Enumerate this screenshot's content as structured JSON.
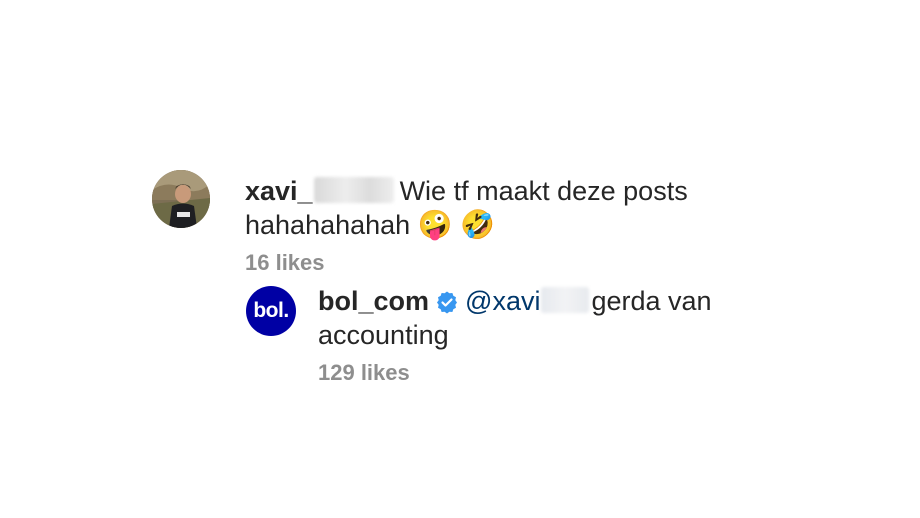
{
  "comments": [
    {
      "username": "xavi_",
      "text": "Wie tf maakt deze posts hahahahahah",
      "emojis": [
        "🤪",
        "🤣"
      ],
      "likes": "16 likes",
      "avatar_icon": "user-avatar-photo"
    }
  ],
  "reply": {
    "username": "bol_com",
    "verified_icon": "verified-badge-icon",
    "mention": "@xavi",
    "text": "gerda van accounting",
    "likes": "129 likes",
    "avatar_logo": "bol.",
    "brand_color": "#0000a4"
  },
  "colors": {
    "mention": "#00376b",
    "likes": "#8e8e8e",
    "verified": "#3897f0"
  }
}
